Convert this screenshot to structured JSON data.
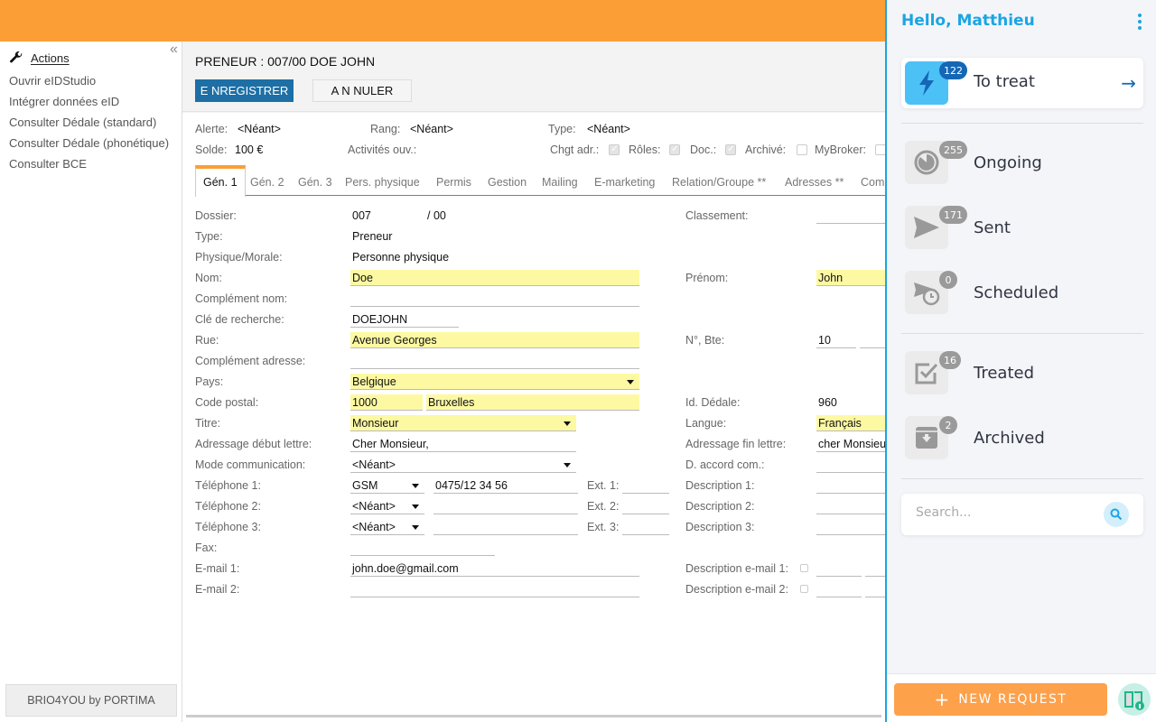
{
  "sidebar": {
    "actions_label": "Actions",
    "items": [
      "Ouvrir eIDStudio",
      "Intégrer données eID",
      "Consulter Dédale (standard)",
      "Consulter Dédale (phonétique)",
      "Consulter BCE"
    ],
    "footer": "BRIO4YOU by PORTIMA"
  },
  "header": {
    "title": "PRENEUR : 007/00 DOE JOHN",
    "save_label": "E NREGISTRER",
    "cancel_label": "A N NULER"
  },
  "summary": {
    "alerte_label": "Alerte:",
    "alerte": "<Néant>",
    "rang_label": "Rang:",
    "rang": "<Néant>",
    "type_label": "Type:",
    "type": "<Néant>",
    "solde_label": "Solde:",
    "solde": "100 €",
    "activites_label": "Activités ouv.:",
    "chgt_label": "Chgt adr.:",
    "roles_label": "Rôles:",
    "doc_label": "Doc.:",
    "archive_label": "Archivé:",
    "mybroker_label": "MyBroker:",
    "chgt": true,
    "roles": true,
    "doc": true,
    "archive": false,
    "mybroker": false
  },
  "tabs": [
    "Gén. 1",
    "Gén. 2",
    "Gén. 3",
    "Pers. physique",
    "Permis",
    "Gestion",
    "Mailing",
    "E-marketing",
    "Relation/Groupe **",
    "Adresses **",
    "Com"
  ],
  "form": {
    "dossier_label": "Dossier:",
    "dossier": "007",
    "dossier_sub": "/ 00",
    "classement_label": "Classement:",
    "type_label": "Type:",
    "type": "Preneur",
    "pm_label": "Physique/Morale:",
    "pm": "Personne physique",
    "nom_label": "Nom:",
    "nom": "Doe",
    "prenom_label": "Prénom:",
    "prenom": "John",
    "compl_nom_label": "Complément nom:",
    "cle_label": "Clé de recherche:",
    "cle": "DOEJOHN",
    "rue_label": "Rue:",
    "rue": "Avenue Georges",
    "num_label": "N°, Bte:",
    "num": "10",
    "compl_adr_label": "Complément adresse:",
    "pays_label": "Pays:",
    "pays": "Belgique",
    "cp_label": "Code postal:",
    "cp": "1000",
    "ville": "Bruxelles",
    "dedale_label": "Id. Dédale:",
    "dedale": "960",
    "titre_label": "Titre:",
    "titre": "Monsieur",
    "langue_label": "Langue:",
    "langue": "Français",
    "adr_debut_label": "Adressage début lettre:",
    "adr_debut": "Cher Monsieur,",
    "adr_fin_label": "Adressage fin lettre:",
    "adr_fin": "cher Monsieur",
    "mode_label": "Mode communication:",
    "mode": "<Néant>",
    "accord_label": "D. accord com.:",
    "tel1_label": "Téléphone 1:",
    "tel1_type": "GSM",
    "tel1": "0475/12 34 56",
    "ext1_label": "Ext. 1:",
    "desc1_label": "Description 1:",
    "tel2_label": "Téléphone 2:",
    "tel2_type": "<Néant>",
    "ext2_label": "Ext. 2:",
    "desc2_label": "Description 2:",
    "tel3_label": "Téléphone 3:",
    "tel3_type": "<Néant>",
    "ext3_label": "Ext. 3:",
    "desc3_label": "Description 3:",
    "fax_label": "Fax:",
    "email1_label": "E-mail 1:",
    "email1": "john.doe@gmail.com",
    "desc_email1_label": "Description e-mail 1:",
    "email2_label": "E-mail 2:",
    "desc_email2_label": "Description e-mail 2:"
  },
  "panel": {
    "greeting": "Hello, Matthieu",
    "search_placeholder": "Search...",
    "new_request": "NEW REQUEST",
    "items": [
      {
        "label": "To treat",
        "count": "122",
        "icon": "lightning-icon"
      },
      {
        "label": "Ongoing",
        "count": "255",
        "icon": "timer-icon"
      },
      {
        "label": "Sent",
        "count": "171",
        "icon": "send-icon"
      },
      {
        "label": "Scheduled",
        "count": "0",
        "icon": "scheduled-send-icon"
      },
      {
        "label": "Treated",
        "count": "16",
        "icon": "checkbox-icon"
      },
      {
        "label": "Archived",
        "count": "2",
        "icon": "archive-icon"
      }
    ],
    "accent": "#1aa5e3",
    "button_color": "#fea14b"
  },
  "colors": {
    "topbar": "#fb9e35",
    "save_button": "#1d6fa5",
    "required_field": "#fdf9a3"
  }
}
